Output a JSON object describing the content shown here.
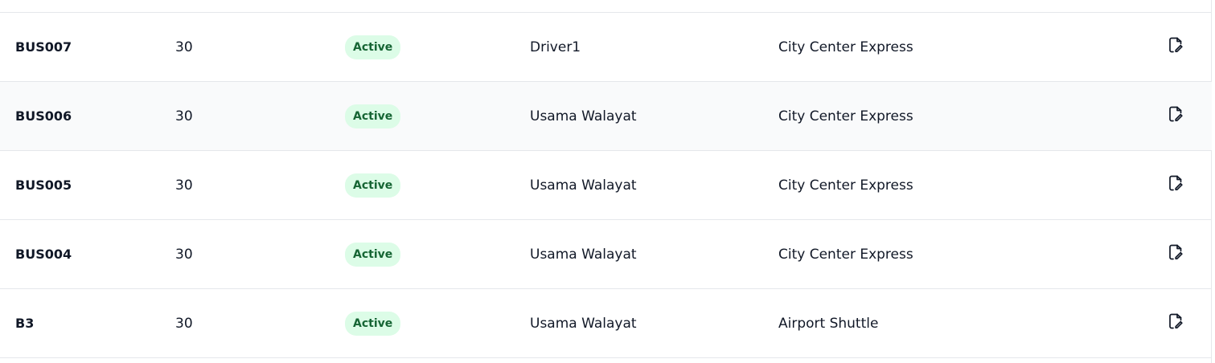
{
  "rows": [
    {
      "bus_number": "BUS007",
      "capacity": "30",
      "status": "Active",
      "driver": "Driver1",
      "route": "City Center Express",
      "action_icon": "edit-document-icon"
    },
    {
      "bus_number": "BUS006",
      "capacity": "30",
      "status": "Active",
      "driver": "Usama Walayat",
      "route": "City Center Express",
      "action_icon": "edit-document-icon"
    },
    {
      "bus_number": "BUS005",
      "capacity": "30",
      "status": "Active",
      "driver": "Usama Walayat",
      "route": "City Center Express",
      "action_icon": "edit-document-icon"
    },
    {
      "bus_number": "BUS004",
      "capacity": "30",
      "status": "Active",
      "driver": "Usama Walayat",
      "route": "City Center Express",
      "action_icon": "edit-document-icon"
    },
    {
      "bus_number": "B3",
      "capacity": "30",
      "status": "Active",
      "driver": "Usama Walayat",
      "route": "Airport Shuttle",
      "action_icon": "edit-document-icon"
    }
  ],
  "colors": {
    "status_active_bg": "#dcfce7",
    "status_active_text": "#166534",
    "row_alt_bg": "#f9fafb",
    "border": "#e5e7eb"
  }
}
